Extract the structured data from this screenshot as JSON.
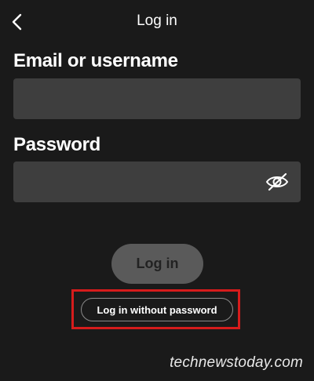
{
  "header": {
    "title": "Log in",
    "back_icon": "chevron-left-icon"
  },
  "form": {
    "email_label": "Email or username",
    "email_value": "",
    "password_label": "Password",
    "password_value": "",
    "password_toggle_icon": "eye-slash-icon"
  },
  "actions": {
    "login_label": "Log in",
    "login_without_password_label": "Log in without password"
  },
  "annotation": {
    "highlight_color": "#d61c1c"
  },
  "watermark": {
    "text": "technewstoday.com"
  },
  "colors": {
    "background": "#1a1a1a",
    "input": "#3e3e3e",
    "login_button_disabled": "#5a5a5a"
  }
}
